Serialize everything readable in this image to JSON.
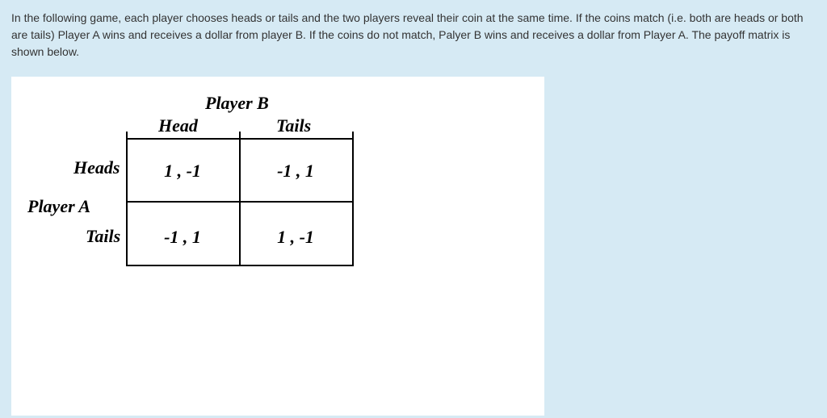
{
  "question": "In the following game, each player chooses heads or tails and the two players reveal their coin at the same time. If the coins match (i.e. both are heads or both are tails) Player A wins and receives a dollar from player B. If the coins do not match, Palyer B wins and receives a dollar from Player A. The payoff matrix is shown below.",
  "players": {
    "row_label": "Player A",
    "col_label": "Player B"
  },
  "columns": {
    "head": "Head",
    "tails": "Tails"
  },
  "rows": {
    "heads": "Heads",
    "tails": "Tails"
  },
  "payoffs": {
    "heads_head": "1 , -1",
    "heads_tails": "-1 , 1",
    "tails_head": "-1 , 1",
    "tails_tails": "1 , -1"
  }
}
